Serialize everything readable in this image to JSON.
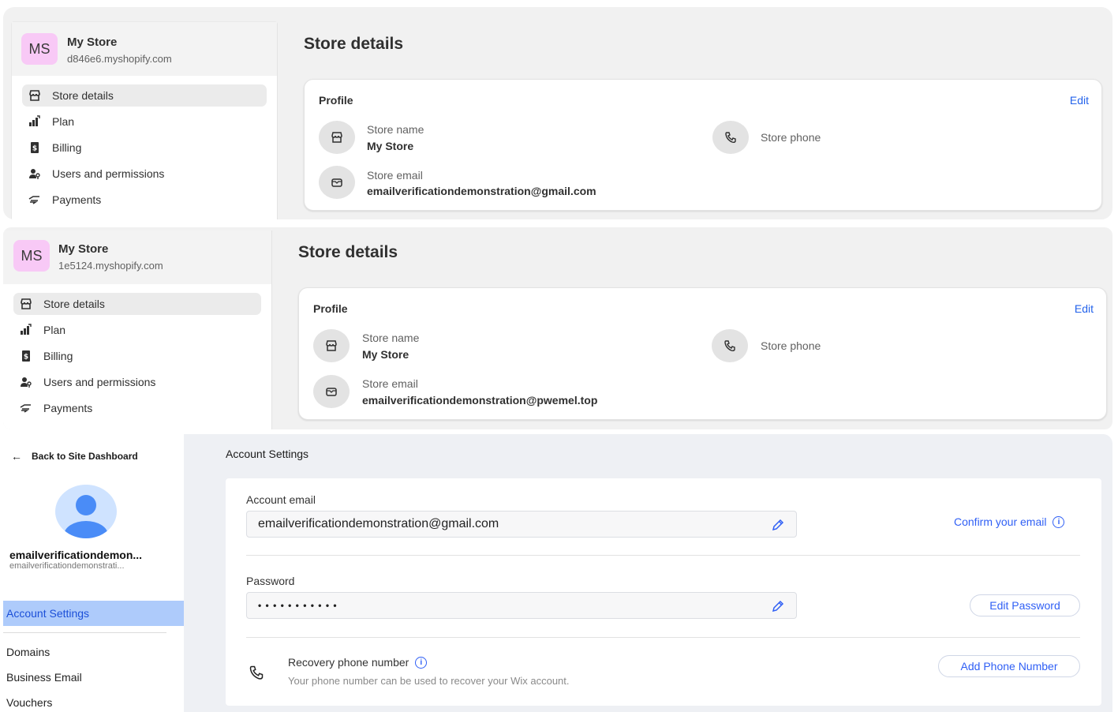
{
  "panel1": {
    "store": {
      "avatar": "MS",
      "name": "My Store",
      "domain": "d846e6.myshopify.com"
    },
    "nav": [
      {
        "label": "Store details",
        "icon": "store-icon",
        "active": true
      },
      {
        "label": "Plan",
        "icon": "plan-icon"
      },
      {
        "label": "Billing",
        "icon": "billing-icon"
      },
      {
        "label": "Users and permissions",
        "icon": "users-icon"
      },
      {
        "label": "Payments",
        "icon": "payments-icon"
      }
    ],
    "title": "Store details",
    "profile": {
      "title": "Profile",
      "edit": "Edit",
      "store_name_label": "Store name",
      "store_name": "My Store",
      "store_phone_label": "Store phone",
      "store_email_label": "Store email",
      "store_email": "emailverificationdemonstration@gmail.com"
    }
  },
  "panel2": {
    "store": {
      "avatar": "MS",
      "name": "My Store",
      "domain": "1e5124.myshopify.com"
    },
    "nav": [
      {
        "label": "Store details",
        "icon": "store-icon",
        "active": true
      },
      {
        "label": "Plan",
        "icon": "plan-icon"
      },
      {
        "label": "Billing",
        "icon": "billing-icon"
      },
      {
        "label": "Users and permissions",
        "icon": "users-icon"
      },
      {
        "label": "Payments",
        "icon": "payments-icon"
      }
    ],
    "title": "Store details",
    "profile": {
      "title": "Profile",
      "edit": "Edit",
      "store_name_label": "Store name",
      "store_name": "My Store",
      "store_phone_label": "Store phone",
      "store_email_label": "Store email",
      "store_email": "emailverificationdemonstration@pwemel.top"
    }
  },
  "wix": {
    "back_label": "Back to Site Dashboard",
    "user_name": "emailverificationdemon...",
    "user_email": "emailverificationdemonstrati...",
    "nav_active": "Account Settings",
    "nav": [
      "Domains",
      "Business Email",
      "Vouchers"
    ],
    "page_title": "Account Settings",
    "account_email_label": "Account email",
    "account_email": "emailverificationdemonstration@gmail.com",
    "confirm_email": "Confirm your email",
    "password_label": "Password",
    "password_mask": "• • • • • • • • • • •",
    "edit_password": "Edit Password",
    "recovery_label": "Recovery phone number",
    "recovery_help": "Your phone number can be used to recover your Wix account.",
    "add_phone": "Add Phone Number",
    "colors": {
      "accent": "#2f5ff5",
      "active_bg": "#aecbfb",
      "shopify_link": "#2463eb"
    }
  }
}
